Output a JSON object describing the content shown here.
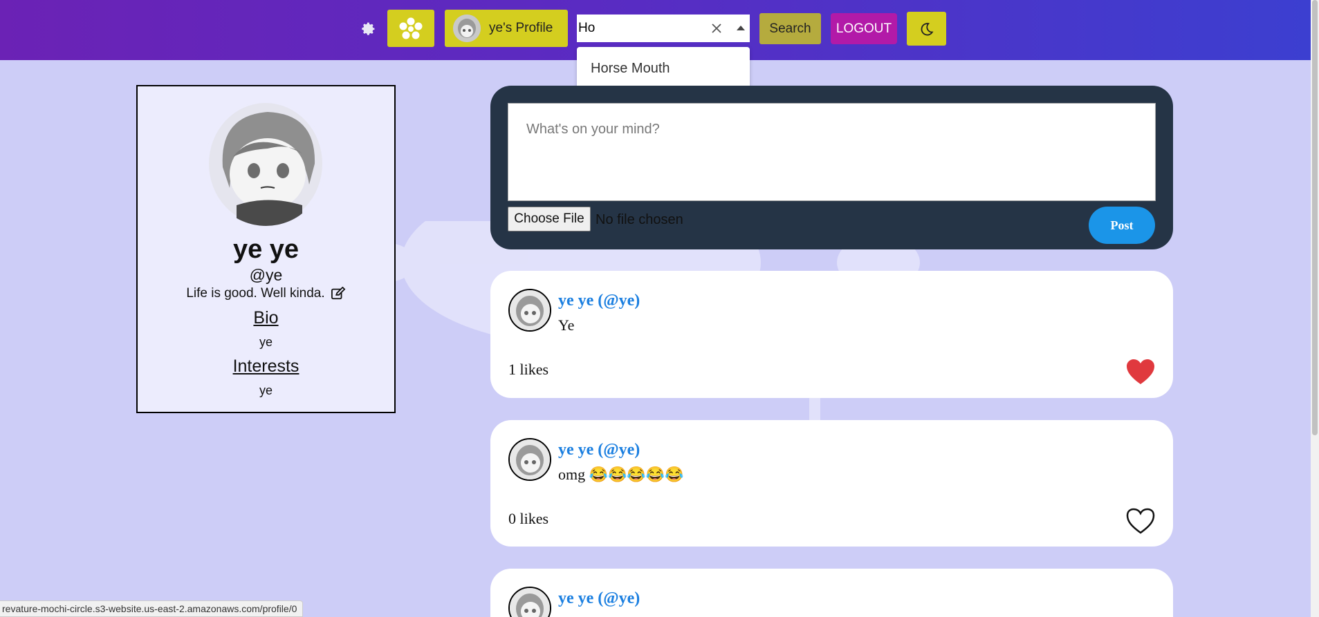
{
  "nav": {
    "profile_label": "ye's Profile",
    "search_value": "Ho",
    "search_suggestion": "Horse Mouth",
    "search_button": "Search",
    "logout_button": "LOGOUT"
  },
  "profile": {
    "name": "ye ye",
    "handle": "@ye",
    "status": "Life is good. Well kinda.",
    "bio_heading": "Bio",
    "bio_value": "ye",
    "interests_heading": "Interests",
    "interests_value": "ye"
  },
  "composer": {
    "placeholder": "What's on your mind?",
    "file_button": "Choose File",
    "file_status": "No file chosen",
    "post_button": "Post"
  },
  "posts": [
    {
      "author": "ye ye (@ye)",
      "body": "Ye",
      "likes": "1 likes",
      "liked": true
    },
    {
      "author": "ye ye (@ye)",
      "body": "omg 😂😂😂😂😂",
      "likes": "0 likes",
      "liked": false
    },
    {
      "author": "ye ye (@ye)",
      "body": "",
      "likes": "",
      "liked": false
    }
  ],
  "statusbar": {
    "url": "revature-mochi-circle.s3-website.us-east-2.amazonaws.com/profile/0"
  },
  "colors": {
    "accent_yellow": "#d4ce1f",
    "logout_magenta": "#b21aa8",
    "post_blue": "#1b95e8",
    "like_red": "#e0393e",
    "page_bg": "#cdcdf7"
  }
}
